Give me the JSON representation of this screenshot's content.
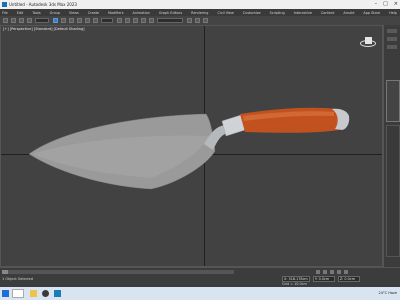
{
  "window": {
    "title": "Untitled - Autodesk 3ds Max 2023"
  },
  "menu": [
    "File",
    "Edit",
    "Tools",
    "Group",
    "Views",
    "Create",
    "Modifiers",
    "Animation",
    "Graph Editors",
    "Rendering",
    "Civil View",
    "Customize",
    "Scripting",
    "Interactive",
    "Content",
    "Arnold",
    "App Store",
    "Help"
  ],
  "viewport": {
    "label": "[+] [Perspective] [Standard] [Default Shading]"
  },
  "status": {
    "left": "1 Object Selected",
    "x": "X: 318.178cm",
    "y": "Y: 0.0cm",
    "z": "Z: 0.0cm",
    "grid": "Grid = 10.0cm"
  },
  "taskbar": {
    "tray_text": "24°C  Haze"
  },
  "colors": {
    "handle": "#c1521f",
    "blade": "#9a9a9a",
    "ferrule": "#cfd2d6",
    "viewport_bg": "#424242"
  },
  "icons": [
    "windows-start-icon",
    "search-icon",
    "file-explorer-icon",
    "chrome-icon",
    "3dsmax-icon",
    "viewcube-icon",
    "home-icon"
  ]
}
